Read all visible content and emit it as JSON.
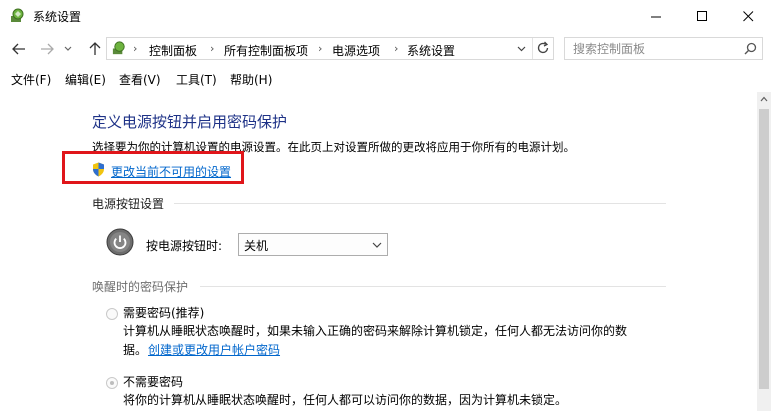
{
  "window": {
    "title": "系统设置",
    "app_icon": "power-options-icon",
    "controls": [
      "minimize-icon",
      "maximize-icon",
      "close-icon"
    ]
  },
  "nav": {
    "back_icon": "arrow-left-icon",
    "forward_icon": "arrow-right-icon",
    "recent_icon": "chevron-down-icon",
    "up_icon": "arrow-up-icon",
    "breadcrumbs": [
      "控制面板",
      "所有控制面板项",
      "电源选项",
      "系统设置"
    ],
    "refresh_icon": "refresh-icon",
    "search_placeholder": "搜索控制面板"
  },
  "menu": [
    "文件(F)",
    "编辑(E)",
    "查看(V)",
    "工具(T)",
    "帮助(H)"
  ],
  "main": {
    "title": "定义电源按钮并启用密码保护",
    "description": "选择要为你的计算机设置的电源设置。在此页上对设置所做的更改将应用于你所有的电源计划。",
    "change_settings_link": "更改当前不可用的设置",
    "power_section": {
      "heading": "电源按钮设置",
      "label": "按电源按钮时:",
      "selected": "关机"
    },
    "wake_section": {
      "heading": "唤醒时的密码保护",
      "option_require": {
        "label": "需要密码(推荐)",
        "desc_line1": "计算机从睡眠状态唤醒时，如果未输入正确的密码来解除计算机锁定，任何人都无法访问你的数",
        "desc_line2_prefix": "据。",
        "link": "创建或更改用户帐户密码"
      },
      "option_no_require": {
        "label": "不需要密码",
        "desc": "将你的计算机从睡眠状态唤醒时，任何人都可以访问你的数据，因为计算机未锁定。"
      }
    }
  },
  "colors": {
    "title_blue": "#1e3287",
    "link_blue": "#0066cc",
    "highlight_red": "#e0151a"
  }
}
